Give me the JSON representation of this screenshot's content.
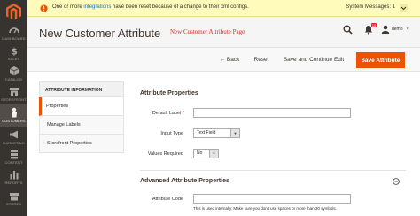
{
  "sidebar": {
    "items": [
      {
        "label": "DASHBOARD",
        "icon": "dashboard-icon"
      },
      {
        "label": "SALES",
        "icon": "dollar-icon"
      },
      {
        "label": "CATALOG",
        "icon": "box-icon"
      },
      {
        "label": "STOREFRONT",
        "icon": "storefront-icon"
      },
      {
        "label": "CUSTOMERS",
        "icon": "customer-icon"
      },
      {
        "label": "MARKETING",
        "icon": "megaphone-icon"
      },
      {
        "label": "CONTENT",
        "icon": "content-icon"
      },
      {
        "label": "REPORTS",
        "icon": "bar-chart-icon"
      },
      {
        "label": "STORES",
        "icon": "store-icon"
      }
    ]
  },
  "notice": {
    "prefix": "One or more ",
    "link": "integrations",
    "suffix": " have been reset because of a change to their xml configs.",
    "system_messages": "System Messages: 1"
  },
  "header": {
    "title": "New Customer Attribute",
    "annotation": "New Customer Attribute Page",
    "notification_count": "10",
    "username": "demo"
  },
  "actions": {
    "back": "Back",
    "reset": "Reset",
    "save_continue": "Save and Continue Edit",
    "save": "Save Attribute"
  },
  "tabs": {
    "title": "ATTRIBUTE INFORMATION",
    "items": [
      "Properties",
      "Manage Labels",
      "Storefront Properties"
    ]
  },
  "attribute_properties": {
    "title": "Attribute Properties",
    "default_label": "Default Label",
    "input_type_label": "Input Type",
    "input_type_value": "Text Field",
    "values_required_label": "Values Required",
    "values_required_value": "No"
  },
  "advanced": {
    "title": "Advanced Attribute Properties",
    "attribute_code_label": "Attribute Code",
    "attribute_code_note": "This is used internally. Make sure you don't use spaces or more than 30 symbols."
  },
  "colors": {
    "accent": "#eb5202",
    "sidebar": "#373330",
    "notice": "#fffbbb",
    "annotation": "#e22626"
  }
}
